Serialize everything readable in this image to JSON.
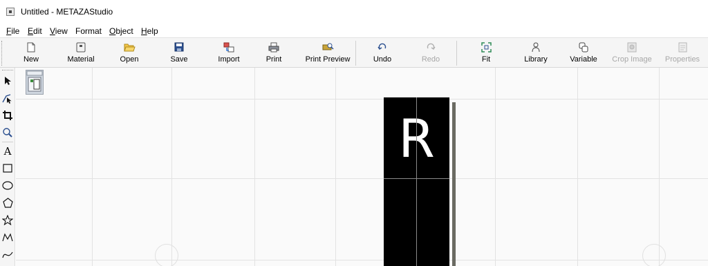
{
  "window": {
    "title": "Untitled - METAZAStudio"
  },
  "menu": [
    {
      "label": "File",
      "underline": "F",
      "rest": "ile"
    },
    {
      "label": "Edit",
      "underline": "E",
      "rest": "dit"
    },
    {
      "label": "View",
      "underline": "V",
      "rest": "iew"
    },
    {
      "label": "Format",
      "underline": "",
      "rest": "Format"
    },
    {
      "label": "Object",
      "underline": "O",
      "rest": "bject"
    },
    {
      "label": "Help",
      "underline": "H",
      "rest": "elp"
    }
  ],
  "toolbar": {
    "new": "New",
    "material": "Material",
    "open": "Open",
    "save": "Save",
    "import": "Import",
    "print": "Print",
    "print_preview": "Print Preview",
    "undo": "Undo",
    "redo": "Redo",
    "fit": "Fit",
    "library": "Library",
    "variable": "Variable",
    "crop_image": "Crop Image",
    "properties": "Properties"
  },
  "toolbar_state": {
    "redo_disabled": true,
    "crop_image_disabled": true,
    "properties_disabled": true
  },
  "palette": {
    "tools": [
      "select-arrow",
      "node-edit",
      "crop",
      "zoom",
      "text",
      "rectangle",
      "ellipse",
      "polygon",
      "star",
      "polyline",
      "curve"
    ]
  },
  "canvas": {
    "label_text": "R",
    "label_color": "#000000",
    "text_color": "#ffffff"
  }
}
